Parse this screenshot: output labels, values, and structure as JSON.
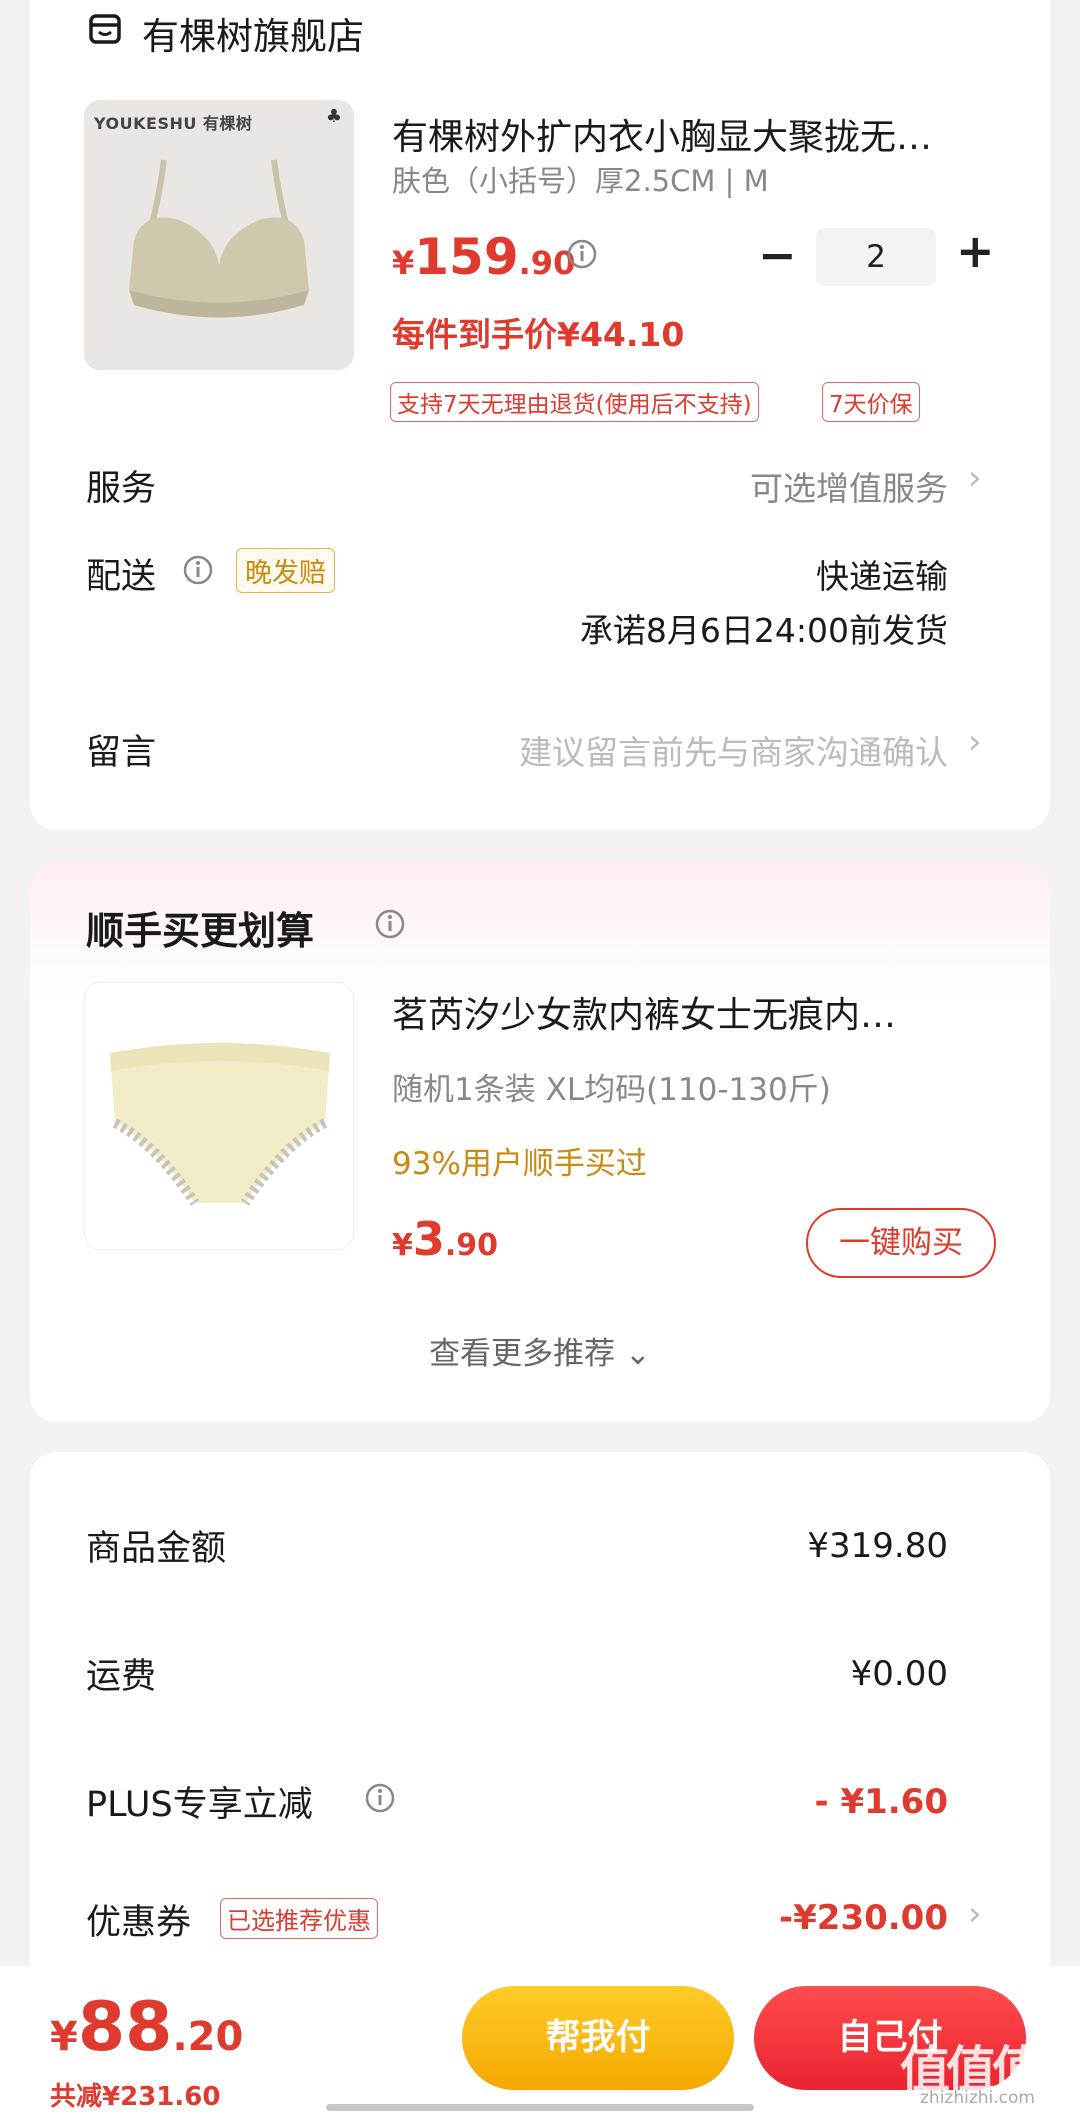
{
  "store": {
    "name": "有棵树旗舰店",
    "icon": "store-icon"
  },
  "product": {
    "thumb_brand": "YOUKESHU 有棵树",
    "thumb_mark": "♣",
    "title": "有棵树外扩内衣小胸显大聚拢无…",
    "spec": "肤色（小括号）厚2.5CM | M",
    "price_yen": "¥",
    "price_int": "159",
    "price_dec": ".90",
    "quantity": "2",
    "minus": "−",
    "plus": "+",
    "unit_price": "每件到手价¥44.10",
    "tags": [
      "支持7天无理由退货(使用后不支持)",
      "7天价保"
    ]
  },
  "rows": {
    "service_label": "服务",
    "service_value": "可选增值服务",
    "delivery_label": "配送",
    "delivery_tag": "晚发赔",
    "delivery_method": "快递运输",
    "delivery_promise": "承诺8月6日24:00前发货",
    "message_label": "留言",
    "message_placeholder": "建议留言前先与商家沟通确认",
    "chevron": "›"
  },
  "recommend": {
    "title": "顺手买更划算",
    "name": "茗芮汐少女款内裤女士无痕内…",
    "spec": "随机1条装   XL均码(110-130斤)",
    "bought": "93%用户顺手买过",
    "price_yen": "¥",
    "price_int": "3",
    "price_dec": ".90",
    "buy_label": "一键购买",
    "more_label": "查看更多推荐 ⌄"
  },
  "summary": {
    "goods_label": "商品金额",
    "goods_value": "¥319.80",
    "shipping_label": "运费",
    "shipping_value": "¥0.00",
    "plus_label": "PLUS专享立减",
    "plus_value": "- ¥1.60",
    "coupon_label": "优惠券",
    "coupon_tag": "已选推荐优惠",
    "coupon_value": "-¥230.00"
  },
  "bottom": {
    "total_yen": "¥",
    "total_int": "88",
    "total_dec": ".20",
    "saved": "共减¥231.60",
    "help_pay": "帮我付",
    "self_pay": "自己付"
  },
  "watermark": {
    "logo": "值值值",
    "site": "zhizhizhi.com"
  },
  "colors": {
    "accent_red": "#e03a2f",
    "gold": "#c98a10",
    "pay_yellow": "#f5a800",
    "pay_red": "#e8232f"
  }
}
